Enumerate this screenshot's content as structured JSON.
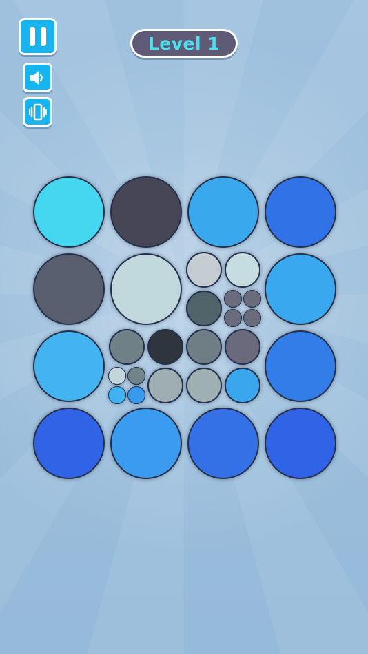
{
  "header": {
    "level_label": "Level 1"
  },
  "controls": [
    {
      "name": "pause-button",
      "icon": "pause-icon"
    },
    {
      "name": "sound-button",
      "icon": "speaker-icon"
    },
    {
      "name": "vibration-button",
      "icon": "vibration-icon"
    }
  ],
  "colors": {
    "button": "#18b4ef",
    "pill_bg": "#5f5b76",
    "pill_text": "#4fe1ef"
  },
  "board": {
    "rows": 4,
    "cols": 4,
    "cells": [
      {
        "row": 0,
        "col": 0,
        "split": 1,
        "colors": [
          "#45d6f0"
        ]
      },
      {
        "row": 0,
        "col": 1,
        "split": 1,
        "colors": [
          "#474656"
        ]
      },
      {
        "row": 0,
        "col": 2,
        "split": 1,
        "colors": [
          "#3aa8ed"
        ]
      },
      {
        "row": 0,
        "col": 3,
        "split": 1,
        "colors": [
          "#3173e6"
        ]
      },
      {
        "row": 1,
        "col": 0,
        "split": 1,
        "colors": [
          "#5a5f6f"
        ]
      },
      {
        "row": 1,
        "col": 1,
        "split": 1,
        "colors": [
          "#c1d8dd"
        ]
      },
      {
        "row": 1,
        "col": 2,
        "split": 2,
        "colors": [
          "#c3cdd2",
          "#c5dde0",
          "#4f6569",
          {
            "split": 2,
            "colors": [
              "#6a6c7e",
              "#6a6c7e",
              "#6a6c7e",
              "#6a6c7e"
            ]
          }
        ]
      },
      {
        "row": 1,
        "col": 3,
        "split": 1,
        "colors": [
          "#3aa8ee"
        ]
      },
      {
        "row": 2,
        "col": 0,
        "split": 1,
        "colors": [
          "#43b3f2"
        ]
      },
      {
        "row": 2,
        "col": 1,
        "split": 2,
        "colors": [
          "#6f8086",
          "#2f353f",
          {
            "split": 2,
            "colors": [
              "#c3d6dc",
              "#71848a",
              "#42b1ef",
              "#3999eb"
            ]
          },
          "#9eaeb2"
        ]
      },
      {
        "row": 2,
        "col": 2,
        "split": 2,
        "colors": [
          "#6f7e84",
          "#6a6a7c",
          "#9fb0b2",
          "#3aa6ed"
        ]
      },
      {
        "row": 2,
        "col": 3,
        "split": 1,
        "colors": [
          "#337de8"
        ]
      },
      {
        "row": 3,
        "col": 0,
        "split": 1,
        "colors": [
          "#3163e6"
        ]
      },
      {
        "row": 3,
        "col": 1,
        "split": 1,
        "colors": [
          "#3b9bee"
        ]
      },
      {
        "row": 3,
        "col": 2,
        "split": 1,
        "colors": [
          "#3470e6"
        ]
      },
      {
        "row": 3,
        "col": 3,
        "split": 1,
        "colors": [
          "#3063e5"
        ]
      }
    ]
  }
}
